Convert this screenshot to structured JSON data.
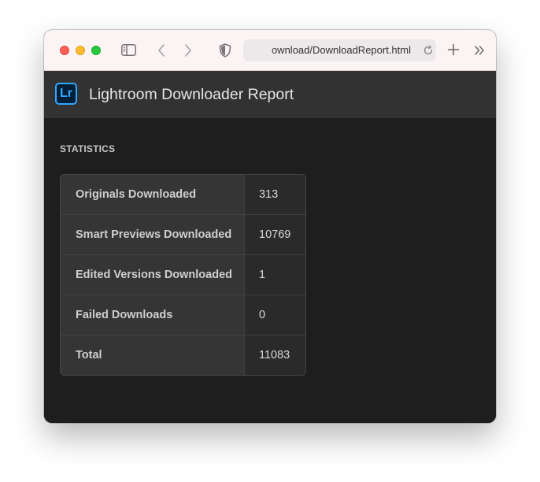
{
  "browser": {
    "url": "ownload/DownloadReport.html"
  },
  "app": {
    "logo_text": "Lr",
    "title": "Lightroom Downloader Report"
  },
  "statistics": {
    "heading": "STATISTICS",
    "rows": [
      {
        "label": "Originals Downloaded",
        "value": "313"
      },
      {
        "label": "Smart Previews Downloaded",
        "value": "10769"
      },
      {
        "label": "Edited Versions Downloaded",
        "value": "1"
      },
      {
        "label": "Failed Downloads",
        "value": "0"
      },
      {
        "label": "Total",
        "value": "11083"
      }
    ]
  },
  "colors": {
    "logo_accent": "#31a8ff",
    "header_bg": "#323232",
    "content_bg": "#1e1e1e"
  }
}
